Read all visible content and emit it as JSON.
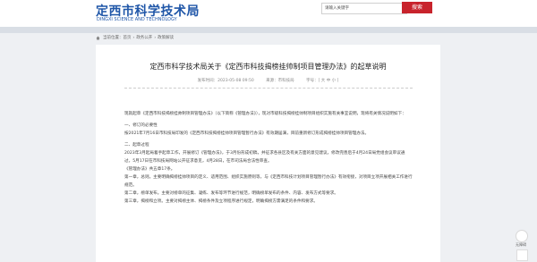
{
  "header": {
    "title": "定西市科学技术局",
    "subtitle": "DINGXI SCIENCE AND TECHNOLOGY",
    "search_placeholder": "请输入关键字",
    "search_button": "搜索"
  },
  "breadcrumb": [
    "当前位置：",
    "首页",
    "政务公开",
    "政策解读"
  ],
  "article": {
    "title": "定西市科学技术局关于《定西市科技揭榜挂帅制项目管理办法》的起草说明",
    "date": "发布时间：2023-05-08 09:50",
    "source": "来源：市科技局",
    "font_size": "字号：[ 大 中 小 ]",
    "paragraphs": [
      "现就起草《定西市科技揭榜挂帅制项目管理办法》（以下简称《管理办法》），现对市级科技揭榜挂帅制项目组织实施有关事宜说明，现将有关情况说明如下：",
      "一、修订的必要性",
      "按2021年7月16日市科技局印发的《定西市科技揭榜挂帅项目管理暂行办法》有效期届满，目前重新修订形成揭榜挂帅项目管理办法。",
      "二、起草过程",
      "2023年3月起局着手起草工作，开展修订《管理办法》，于3月份形成初稿，并征求各县区及有关方面的意见建议，修改完善后于4月24日局党组会议审议通过，5月17日在市科技局网站公开征求意见，4月28日，在市司法局合法性审查。",
      "《管理办法》共五章17条。",
      "第一章，总则。主要明确揭榜挂帅项目的定义、适用范围、组织实施原则等，与《定西市科技计划项目管理暂行办法》有效衔接，对项目立项开展相关工作进行规范。",
      "第二章，榜单发布。主要对榜单的征集、凝练、发布等环节进行规范，明确榜单发布的条件、内容、发布方式等要求。",
      "第三章，揭榜和立项。主要对揭榜主体、揭榜条件及立项程序进行规定，明确揭榜方需满足的条件和要求。"
    ]
  },
  "float_widget": {
    "label": "无障碍"
  }
}
